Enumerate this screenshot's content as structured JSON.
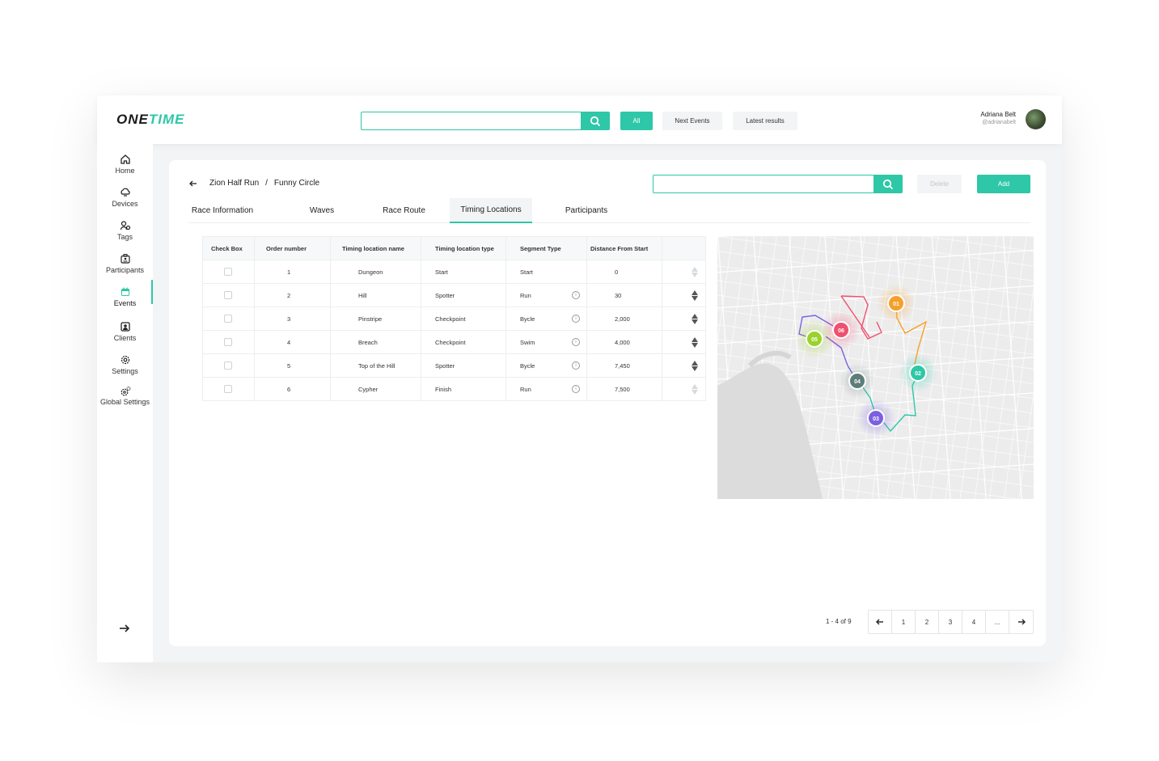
{
  "brand": {
    "one": "ONE",
    "time": "TIME"
  },
  "topbar": {
    "search_placeholder": "",
    "filters": {
      "all": "All",
      "next": "Next Events",
      "latest": "Latest results"
    },
    "user": {
      "name": "Adriana Belt",
      "handle": "@adrianabelt"
    }
  },
  "sidebar": {
    "items": [
      {
        "label": "Home",
        "icon": "home-icon"
      },
      {
        "label": "Devices",
        "icon": "devices-icon"
      },
      {
        "label": "Tags",
        "icon": "tags-icon"
      },
      {
        "label": "Participants",
        "icon": "participants-icon"
      },
      {
        "label": "Events",
        "icon": "events-icon",
        "active": true
      },
      {
        "label": "Clients",
        "icon": "clients-icon"
      },
      {
        "label": "Settings",
        "icon": "gear-icon"
      },
      {
        "label": "Global Settings",
        "icon": "global-settings-icon"
      }
    ],
    "logout_icon": "arrow-right-icon"
  },
  "breadcrumb": {
    "event": "Zion Half Run",
    "separator": "/",
    "race": "Funny Circle"
  },
  "actions": {
    "delete": "Delete",
    "add": "Add"
  },
  "tabs": [
    {
      "label": "Race Information"
    },
    {
      "label": "Waves"
    },
    {
      "label": "Race Route"
    },
    {
      "label": "Timing Locations",
      "active": true
    },
    {
      "label": "Participants"
    }
  ],
  "table": {
    "headers": [
      "Check Box",
      "Order number",
      "Timing location name",
      "Timing location type",
      "Segment Type",
      "Distance From Start"
    ],
    "rows": [
      {
        "order": "1",
        "name": "Dungeon",
        "type": "Start",
        "segment": "Start",
        "distance": "0"
      },
      {
        "order": "2",
        "name": "Hill",
        "type": "Spotter",
        "segment": "Run",
        "distance": "30"
      },
      {
        "order": "3",
        "name": "Pinstripe",
        "type": "Checkpoint",
        "segment": "Bycle",
        "distance": "2,000"
      },
      {
        "order": "4",
        "name": "Breach",
        "type": "Checkpoint",
        "segment": "Swim",
        "distance": "4,000"
      },
      {
        "order": "5",
        "name": "Top of the Hill",
        "type": "Spotter",
        "segment": "Bycle",
        "distance": "7,450"
      },
      {
        "order": "6",
        "name": "Cypher",
        "type": "Finish",
        "segment": "Run",
        "distance": "7,500"
      }
    ]
  },
  "map": {
    "markers": [
      {
        "label": "01",
        "color": "#f5a02a"
      },
      {
        "label": "02",
        "color": "#2ec7a7"
      },
      {
        "label": "03",
        "color": "#7b61e0"
      },
      {
        "label": "04",
        "color": "#5f7d78"
      },
      {
        "label": "05",
        "color": "#9bd22a"
      },
      {
        "label": "06",
        "color": "#f0506e"
      }
    ]
  },
  "pagination": {
    "summary": "1 - 4 of 9",
    "pages": [
      "1",
      "2",
      "3",
      "4",
      "..."
    ]
  },
  "colors": {
    "accent": "#2ec7a7"
  }
}
